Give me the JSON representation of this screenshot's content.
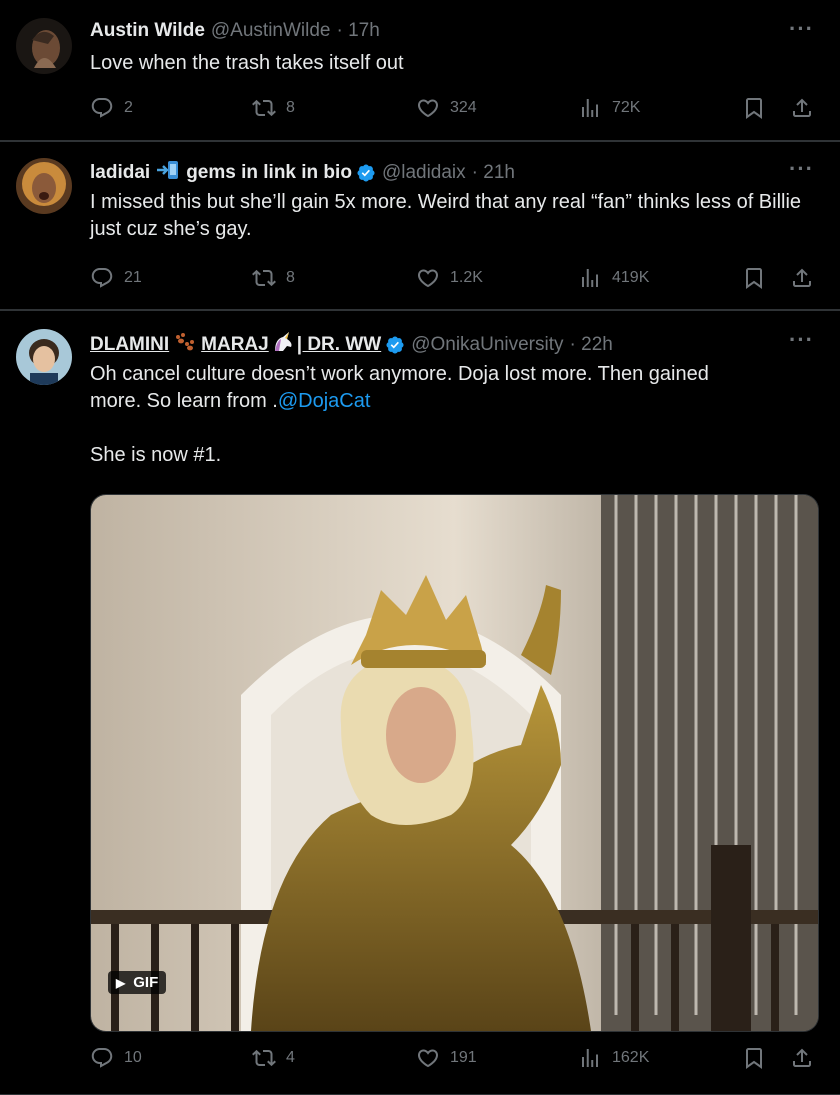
{
  "colors": {
    "background": "#000000",
    "text": "#e7e9ea",
    "muted": "#71767b",
    "link": "#1d9bf0",
    "verified": "#1d9bf0"
  },
  "tweets": [
    {
      "name": "Austin Wilde",
      "handle": "@AustinWilde",
      "time": "· 17h",
      "text": "Love when the trash takes itself out",
      "replies": "2",
      "retweets": "8",
      "likes": "324",
      "views": "72K"
    },
    {
      "name_prefix": "ladidai",
      "name_suffix": "gems in link in bio",
      "handle": "@ladidaix",
      "time": "· 21h",
      "text": "I missed this but she’ll gain 5x more. Weird that any real “fan” thinks less of Billie just cuz she’s gay.",
      "replies": "21",
      "retweets": "8",
      "likes": "1.2K",
      "views": "419K"
    },
    {
      "name_part1": "DLAMINI",
      "name_part2": "MARAJ",
      "name_part3": "| DR. WW",
      "handle": "@OnikaUniversity",
      "time": "· 22h",
      "text_line1": "Oh cancel culture doesn’t work anymore. Doja lost more. Then gained",
      "text_line2_prefix": "more. So learn from .",
      "mention": "@DojaCat",
      "text_line3": "She is now #1.",
      "media_badge": "GIF",
      "replies": "10",
      "retweets": "4",
      "likes": "191",
      "views": "162K"
    }
  ],
  "more_label": "···"
}
